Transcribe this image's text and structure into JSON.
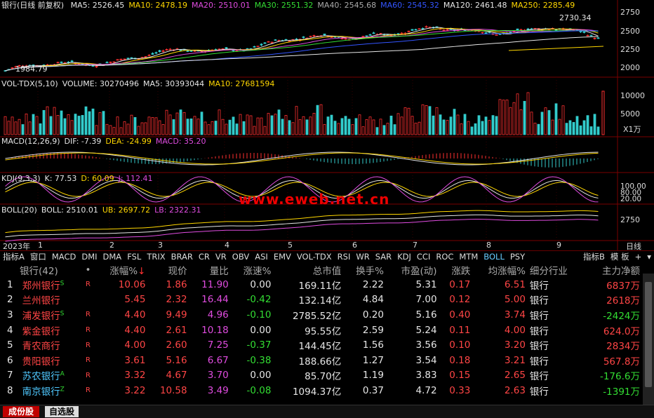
{
  "main": {
    "title": "银行(日线 前复权)",
    "ma": [
      {
        "label": "MA5: 2526.45",
        "color": "#e6e6e6"
      },
      {
        "label": "MA10: 2478.19",
        "color": "#ffd700"
      },
      {
        "label": "MA20: 2510.01",
        "color": "#e04ce0"
      },
      {
        "label": "MA30: 2551.32",
        "color": "#33dd33"
      },
      {
        "label": "MA40: 2545.68",
        "color": "#aaaaaa"
      },
      {
        "label": "MA60: 2545.32",
        "color": "#3355ff"
      },
      {
        "label": "MA120: 2461.48",
        "color": "#e6e6e6"
      },
      {
        "label": "MA250: 2285.49",
        "color": "#ffd700"
      }
    ],
    "yticks": [
      "2750",
      "2500",
      "2250",
      "2000"
    ],
    "high_label": "2730.34",
    "low_label": "1984.79"
  },
  "vol": {
    "labels": [
      {
        "text": "VOL-TDX(5,10)",
        "color": "#e6e6e6"
      },
      {
        "text": "VOLUME: 30270496",
        "color": "#e6e6e6"
      },
      {
        "text": "MA5: 30393044",
        "color": "#e6e6e6"
      },
      {
        "text": "MA10: 27681594",
        "color": "#ffd700"
      }
    ],
    "yticks": [
      "10000",
      "5000"
    ],
    "unit": "X1万"
  },
  "macd": {
    "labels": [
      {
        "text": "MACD(12,26,9)",
        "color": "#e6e6e6"
      },
      {
        "text": "DIF: -7.39",
        "color": "#e6e6e6"
      },
      {
        "text": "DEA: -24.99",
        "color": "#ffd700"
      },
      {
        "text": "MACD: 35.20",
        "color": "#e04ce0"
      }
    ]
  },
  "kdj": {
    "labels": [
      {
        "text": "KDJ(9,3,3)",
        "color": "#e6e6e6"
      },
      {
        "text": "K: 77.53",
        "color": "#e6e6e6"
      },
      {
        "text": "D: 60.09",
        "color": "#ffd700"
      },
      {
        "text": "J: 112.41",
        "color": "#e04ce0"
      }
    ],
    "yticks": [
      "100.00",
      "80.00",
      "20.00"
    ]
  },
  "boll": {
    "labels": [
      {
        "text": "BOLL(20)",
        "color": "#e6e6e6"
      },
      {
        "text": "BOLL: 2510.01",
        "color": "#e6e6e6"
      },
      {
        "text": "UB: 2697.72",
        "color": "#ffd700"
      },
      {
        "text": "LB: 2322.31",
        "color": "#e04ce0"
      }
    ],
    "yticks": [
      "2750"
    ]
  },
  "xaxis": {
    "year": "2023年",
    "months": [
      "1",
      "2",
      "3",
      "4",
      "5",
      "6",
      "7",
      "8",
      "9"
    ],
    "period": "日线"
  },
  "watermark": "www.eweb.net.cn",
  "tabs": [
    "指标A",
    "窗口",
    "MACD",
    "DMI",
    "DMA",
    "FSL",
    "TRIX",
    "BRAR",
    "CR",
    "VR",
    "OBV",
    "ASI",
    "EMV",
    "VOL-TDX",
    "RSI",
    "WR",
    "SAR",
    "KDJ",
    "CCI",
    "ROC",
    "MTM",
    "BOLL",
    "PSY"
  ],
  "tabs_selected": "BOLL",
  "tabs_right": [
    "指标B",
    "模 板",
    "+",
    "▾"
  ],
  "table": {
    "headers": [
      "银行(42)",
      "•",
      "涨幅%↓",
      "现价",
      "量比",
      "涨速%",
      "总市值",
      "换手%",
      "市盈(动)",
      "涨跌",
      "均涨幅%",
      "细分行业",
      "主力净额"
    ],
    "rows": [
      {
        "no": "1",
        "name": "郑州银行",
        "sup": "S",
        "flag": "R",
        "chg": "10.06",
        "price": "1.86",
        "vr": "11.90",
        "speed": "0.00",
        "cap": "169.11亿",
        "turn": "2.22",
        "pe": "5.31",
        "diff": "0.17",
        "avg": "6.51",
        "ind": "银行",
        "net": "6837万"
      },
      {
        "no": "2",
        "name": "兰州银行",
        "sup": "",
        "flag": "",
        "chg": "5.45",
        "price": "2.32",
        "vr": "16.44",
        "speed": "-0.42",
        "cap": "132.14亿",
        "turn": "4.84",
        "pe": "7.00",
        "diff": "0.12",
        "avg": "5.00",
        "ind": "银行",
        "net": "2618万"
      },
      {
        "no": "3",
        "name": "浦发银行",
        "sup": "S",
        "flag": "R",
        "chg": "4.40",
        "price": "9.49",
        "vr": "4.96",
        "speed": "-0.10",
        "cap": "2785.52亿",
        "turn": "0.20",
        "pe": "5.16",
        "diff": "0.40",
        "avg": "3.74",
        "ind": "银行",
        "net": "-2424万"
      },
      {
        "no": "4",
        "name": "紫金银行",
        "sup": "",
        "flag": "R",
        "chg": "4.40",
        "price": "2.61",
        "vr": "10.18",
        "speed": "0.00",
        "cap": "95.55亿",
        "turn": "2.59",
        "pe": "5.24",
        "diff": "0.11",
        "avg": "4.00",
        "ind": "银行",
        "net": "624.0万"
      },
      {
        "no": "5",
        "name": "青农商行",
        "sup": "",
        "flag": "R",
        "chg": "4.00",
        "price": "2.60",
        "vr": "7.25",
        "speed": "-0.37",
        "cap": "144.45亿",
        "turn": "1.56",
        "pe": "3.56",
        "diff": "0.10",
        "avg": "3.20",
        "ind": "银行",
        "net": "2834万"
      },
      {
        "no": "6",
        "name": "贵阳银行",
        "sup": "",
        "flag": "R",
        "chg": "3.61",
        "price": "5.16",
        "vr": "6.67",
        "speed": "-0.38",
        "cap": "188.66亿",
        "turn": "1.27",
        "pe": "3.54",
        "diff": "0.18",
        "avg": "3.21",
        "ind": "银行",
        "net": "567.8万"
      },
      {
        "no": "7",
        "name": "苏农银行",
        "sup": "A",
        "flag": "R",
        "chg": "3.32",
        "price": "4.67",
        "vr": "3.70",
        "speed": "0.00",
        "cap": "85.70亿",
        "turn": "1.19",
        "pe": "3.83",
        "diff": "0.15",
        "avg": "2.65",
        "ind": "银行",
        "net": "-176.6万"
      },
      {
        "no": "8",
        "name": "南京银行",
        "sup": "Z",
        "flag": "R",
        "chg": "3.22",
        "price": "10.58",
        "vr": "3.49",
        "speed": "-0.08",
        "cap": "1094.37亿",
        "turn": "0.37",
        "pe": "4.72",
        "diff": "0.33",
        "avg": "2.63",
        "ind": "银行",
        "net": "-1391万"
      }
    ]
  },
  "bottom_tabs": [
    "成份股",
    "自选股"
  ]
}
